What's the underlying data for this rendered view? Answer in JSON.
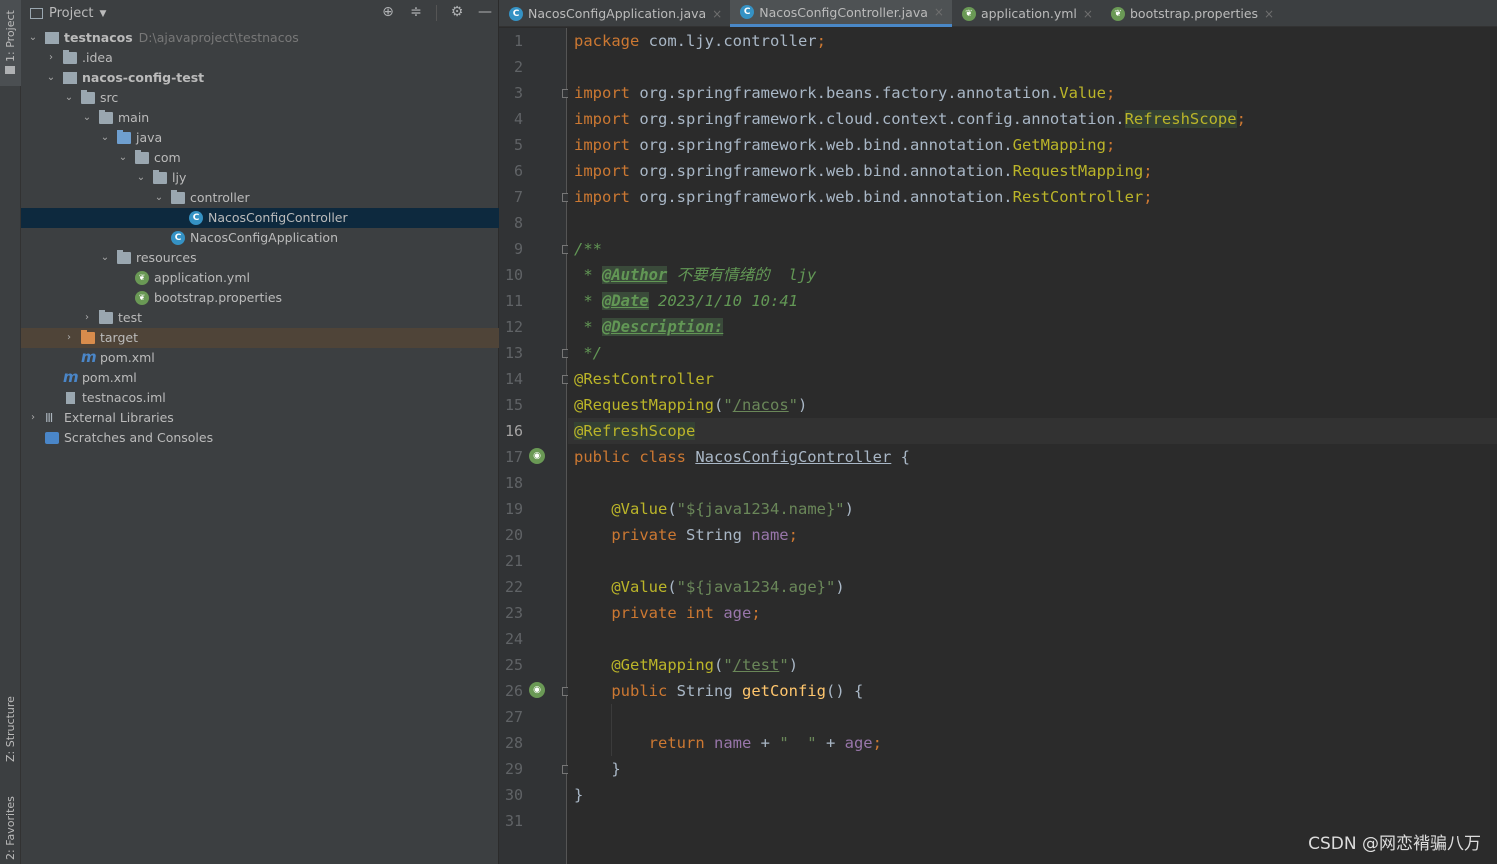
{
  "tool_strip": {
    "project_tab": "1: Project",
    "structure_tab": "Z: Structure",
    "favorites_tab": "2: Favorites"
  },
  "project_panel": {
    "title": "Project",
    "tree": [
      {
        "label": "testnacos",
        "path": "D:\\ajavaproject\\testnacos"
      },
      {
        "label": ".idea"
      },
      {
        "label": "nacos-config-test"
      },
      {
        "label": "src"
      },
      {
        "label": "main"
      },
      {
        "label": "java"
      },
      {
        "label": "com"
      },
      {
        "label": "ljy"
      },
      {
        "label": "controller"
      },
      {
        "label": "NacosConfigController"
      },
      {
        "label": "NacosConfigApplication"
      },
      {
        "label": "resources"
      },
      {
        "label": "application.yml"
      },
      {
        "label": "bootstrap.properties"
      },
      {
        "label": "test"
      },
      {
        "label": "target"
      },
      {
        "label": "pom.xml"
      },
      {
        "label": "pom.xml"
      },
      {
        "label": "testnacos.iml"
      },
      {
        "label": "External Libraries"
      },
      {
        "label": "Scratches and Consoles"
      }
    ]
  },
  "editor_tabs": [
    {
      "label": "NacosConfigApplication.java",
      "icon": "spring-class-icon"
    },
    {
      "label": "NacosConfigController.java",
      "icon": "class-icon"
    },
    {
      "label": "application.yml",
      "icon": "spring-icon"
    },
    {
      "label": "bootstrap.properties",
      "icon": "spring-icon"
    }
  ],
  "editor": {
    "current_line": 16,
    "lines": {
      "l1": [
        "package",
        " com.ljy.controller",
        ";"
      ],
      "l3": [
        "import",
        " org.springframework.beans.factory.annotation.",
        "Value",
        ";"
      ],
      "l4": [
        "import",
        " org.springframework.cloud.context.config.annotation.",
        "RefreshScope",
        ";"
      ],
      "l5": [
        "import",
        " org.springframework.web.bind.annotation.",
        "GetMapping",
        ";"
      ],
      "l6": [
        "import",
        " org.springframework.web.bind.annotation.",
        "RequestMapping",
        ";"
      ],
      "l7": [
        "import",
        " org.springframework.web.bind.annotation.",
        "RestController",
        ";"
      ],
      "l9": "/**",
      "l10": [
        " * ",
        "@Author",
        " 不要有情绪的  ljy"
      ],
      "l11": [
        " * ",
        "@Date",
        " 2023/1/10 10:41"
      ],
      "l12": [
        " * ",
        "@Description:"
      ],
      "l13": " */",
      "l14": "@RestController",
      "l15": [
        "@RequestMapping",
        "(",
        "\"",
        "/nacos",
        "\"",
        ")"
      ],
      "l16": "@RefreshScope",
      "l17": [
        "public class ",
        "NacosConfigController",
        " {"
      ],
      "l19": [
        "    ",
        "@Value",
        "(",
        "\"${java1234.name}\"",
        ")"
      ],
      "l20": [
        "    ",
        "private ",
        "String ",
        "name",
        ";"
      ],
      "l22": [
        "    ",
        "@Value",
        "(",
        "\"${java1234.age}\"",
        ")"
      ],
      "l23": [
        "    ",
        "private int ",
        "age",
        ";"
      ],
      "l25": [
        "    ",
        "@GetMapping",
        "(",
        "\"",
        "/test",
        "\"",
        ")"
      ],
      "l26": [
        "    ",
        "public ",
        "String ",
        "getConfig",
        "() {"
      ],
      "l28": [
        "        ",
        "return ",
        "name",
        " + ",
        "\"  \"",
        " + ",
        "age",
        ";"
      ],
      "l29": "    }",
      "l30": "}"
    }
  },
  "watermark": "CSDN @网恋褙骗八万"
}
